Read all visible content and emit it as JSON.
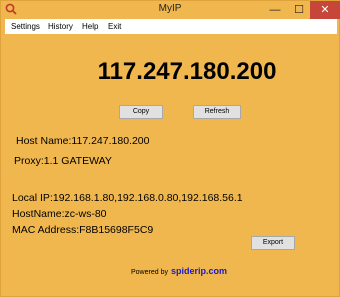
{
  "window": {
    "title": "MyIP",
    "minimize_glyph": "—",
    "maximize_glyph": "☐",
    "close_glyph": "✕",
    "background_color": "#f0b74e"
  },
  "menu": {
    "items": [
      "Settings",
      "History",
      "Help",
      "Exit"
    ]
  },
  "main": {
    "public_ip": "117.247.180.200",
    "copy_label": "Copy",
    "refresh_label": "Refresh",
    "host_name": "Host Name:117.247.180.200",
    "proxy": "Proxy:1.1 GATEWAY",
    "local_ip": "Local IP:192.168.1.80,192.168.0.80,192.168.56.1",
    "hostname": "HostName:zc-ws-80",
    "mac_address": "MAC Address:F8B15698F5C9",
    "export_label": "Export",
    "powered_by_label": "Powered by",
    "powered_by_link": "spiderip.com",
    "link_color": "#1a1acc"
  },
  "icons": {
    "app": "location-pin-icon"
  }
}
